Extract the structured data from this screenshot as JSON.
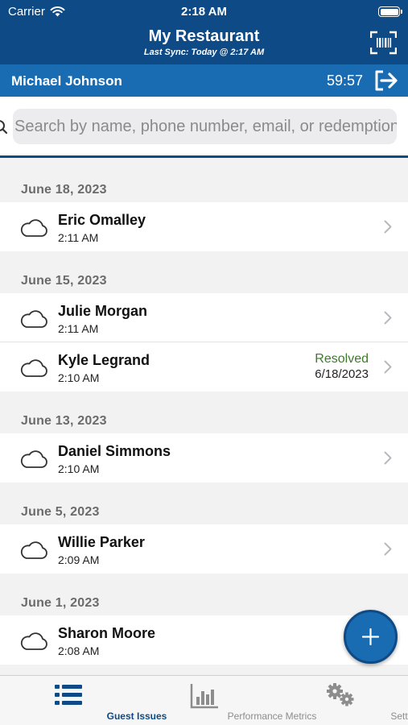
{
  "status_bar": {
    "carrier": "Carrier",
    "time": "2:18 AM"
  },
  "header": {
    "title": "My Restaurant",
    "subtitle": "Last Sync: Today @ 2:17 AM",
    "scan_icon": "barcode-scan-icon"
  },
  "user_bar": {
    "name": "Michael Johnson",
    "timer": "59:57",
    "logout_icon": "logout-icon"
  },
  "search": {
    "placeholder": "Search by name, phone number, email, or redemption code",
    "value": ""
  },
  "groups": [
    {
      "date": "June 18, 2023",
      "items": [
        {
          "name": "Eric Omalley",
          "time": "2:11 AM"
        }
      ]
    },
    {
      "date": "June 15, 2023",
      "items": [
        {
          "name": "Julie Morgan",
          "time": "2:11 AM"
        },
        {
          "name": "Kyle Legrand",
          "time": "2:10 AM",
          "status": "Resolved",
          "status_date": "6/18/2023"
        }
      ]
    },
    {
      "date": "June 13, 2023",
      "items": [
        {
          "name": "Daniel Simmons",
          "time": "2:10 AM"
        }
      ]
    },
    {
      "date": "June 5, 2023",
      "items": [
        {
          "name": "Willie Parker",
          "time": "2:09 AM"
        }
      ]
    },
    {
      "date": "June 1, 2023",
      "items": [
        {
          "name": "Sharon Moore",
          "time": "2:08 AM"
        }
      ]
    }
  ],
  "tabs": [
    {
      "label": "Guest Issues",
      "icon": "list-icon",
      "active": true
    },
    {
      "label": "Performance Metrics",
      "icon": "bar-chart-icon",
      "active": false
    },
    {
      "label": "Settings",
      "icon": "gears-icon",
      "active": false
    }
  ],
  "colors": {
    "primary": "#0d4a86",
    "accent": "#1a6cb2",
    "resolved": "#3d7a2b"
  }
}
